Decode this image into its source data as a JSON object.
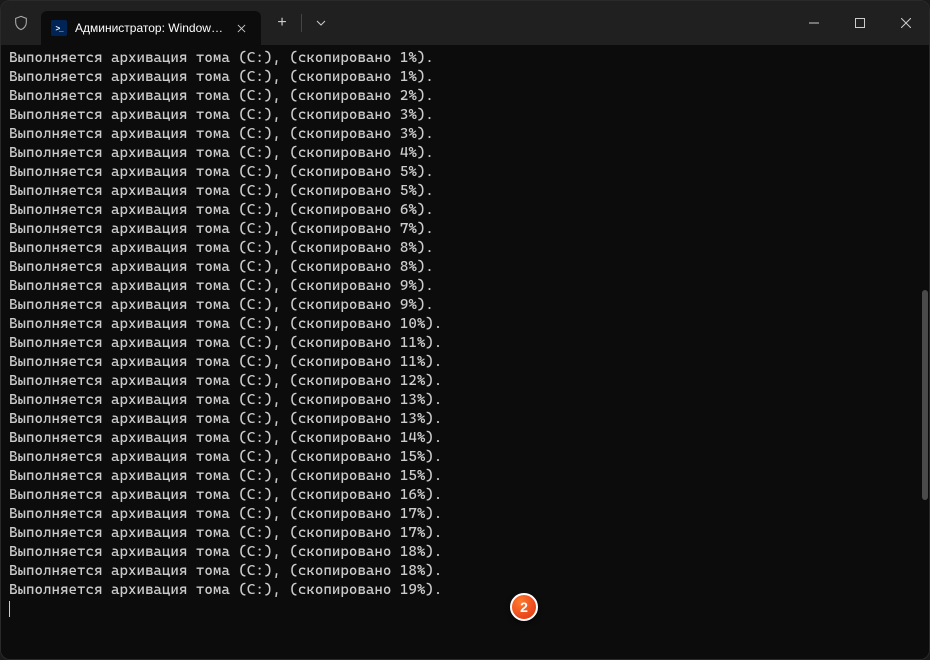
{
  "window": {
    "tab_title": "Администратор: Windows Po",
    "new_tab_label": "+",
    "close_tab_label": "✕"
  },
  "annotation": {
    "number": "2"
  },
  "terminal": {
    "prefix": "Выполняется архивация тома (C:), (скопировано ",
    "suffix": "%).",
    "percents": [
      1,
      1,
      2,
      3,
      3,
      4,
      5,
      5,
      6,
      7,
      8,
      8,
      9,
      9,
      10,
      11,
      11,
      12,
      13,
      13,
      14,
      15,
      15,
      16,
      17,
      17,
      18,
      18,
      19
    ]
  }
}
